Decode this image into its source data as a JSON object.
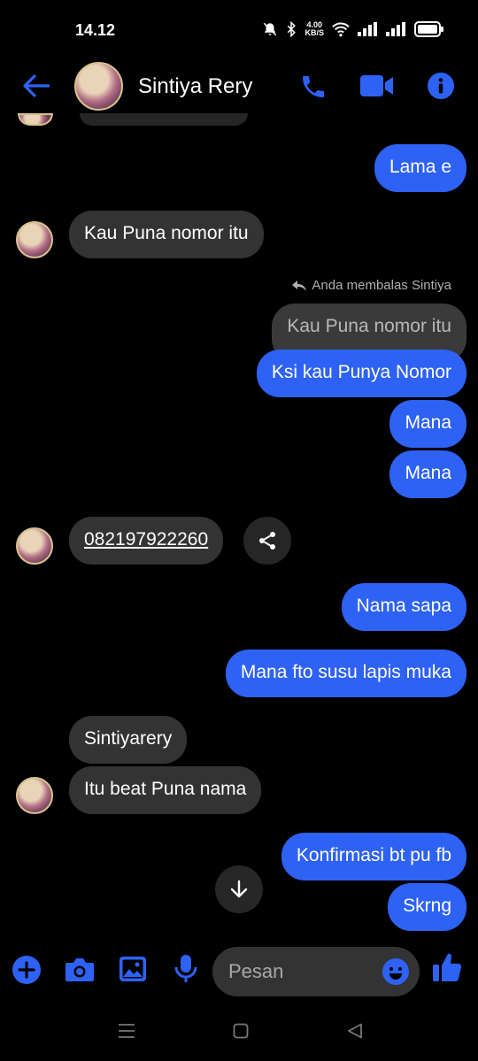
{
  "status": {
    "time": "14.12",
    "speed_value": "4.00",
    "speed_unit": "KB/S"
  },
  "header": {
    "contact_name": "Sintiya Rery"
  },
  "messages": {
    "m1": "Lama e",
    "m2": "Kau Puna nomor itu",
    "reply_note": "Anda membalas Sintiya",
    "quoted": "Kau Puna nomor itu",
    "m3": "Ksi kau Punya Nomor",
    "m4": "Mana",
    "m5": "Mana",
    "phone": "082197922260",
    "m6": "Nama sapa",
    "m7": "Mana fto susu lapis muka",
    "m8": "Sintiyarery",
    "m9": "Itu beat Puna nama",
    "m10": "Konfirmasi bt pu fb",
    "m11": "Skrng"
  },
  "composer": {
    "placeholder": "Pesan"
  },
  "colors": {
    "accent": "#2e62f5",
    "incoming_bubble": "#333334",
    "background": "#000000"
  }
}
